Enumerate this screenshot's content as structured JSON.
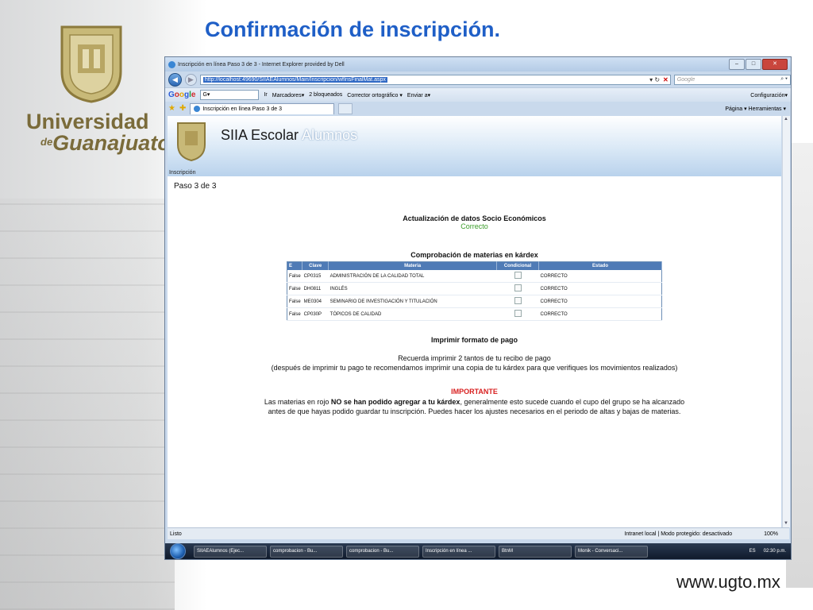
{
  "slide": {
    "title": "Confirmación de inscripción.",
    "university_line1": "Universidad",
    "university_de": "de",
    "university_line2": "Guanajuato",
    "url": "www.ugto.mx"
  },
  "window": {
    "title": "Inscripción en línea Paso 3 de 3 - Internet Explorer provided by Dell",
    "address": "http://localhost:49690/SIIAEAlumnos/Main/Inscripcion/wfInsFinalMat.aspx",
    "search_placeholder": "Google",
    "toolbar": {
      "google_label": "Google",
      "go": "Ir",
      "bookmarks": "Marcadores▾",
      "blocked": "2 bloqueados",
      "spell": "Corrector ortográfico ▾",
      "send": "Enviar a▾",
      "settings": "Configuración▾"
    },
    "tab_label": "Inscripción en línea Paso 3 de 3",
    "command_bar": "Página ▾   Herramientas ▾"
  },
  "page": {
    "app_name": "SIIA Escolar",
    "app_sub": "Alumnos",
    "section_label": "Inscripción",
    "step": "Paso   3 de 3",
    "update_title": "Actualización de datos Socio Económicos",
    "update_status": "Correcto",
    "kardex_title": "Comprobación de materias en kárdex",
    "kardex_headers": [
      "E",
      "Clave",
      "Materia",
      "Condicional",
      "Estado"
    ],
    "kardex_rows": [
      {
        "e": "False",
        "clave": "CP0315",
        "materia": "ADMINISTRACIÓN DE LA CALIDAD TOTAL",
        "estado": "CORRECTO"
      },
      {
        "e": "False",
        "clave": "DH0811",
        "materia": "INGLÉS",
        "estado": "CORRECTO"
      },
      {
        "e": "False",
        "clave": "ME0304",
        "materia": "SEMINARIO DE INVESTIGACIÓN Y TITULACIÓN",
        "estado": "CORRECTO"
      },
      {
        "e": "False",
        "clave": "CP030P",
        "materia": "TÓPICOS DE CALIDAD",
        "estado": "CORRECTO"
      }
    ],
    "print_title": "Imprimir formato de pago",
    "print_line1": "Recuerda imprimir 2 tantos de tu recibo de pago",
    "print_line2": "(después de imprimir tu pago te recomendamos imprimir una copia de tu kárdex para que verifiques los movimientos realizados)",
    "important": "IMPORTANTE",
    "important_pre": "Las materias en rojo ",
    "important_bold": "NO se han podido agregar a tu kárdex",
    "important_post": ", generalmente esto sucede cuando el cupo del grupo se ha alcanzado",
    "important_line2": "antes de que hayas podido guardar tu inscripción. Puedes hacer los ajustes necesarios en el periodo de altas y bajas de materias."
  },
  "statusbar": {
    "left": "Listo",
    "zone": "Intranet local | Modo protegido: desactivado",
    "zoom": "100%"
  },
  "taskbar": {
    "tasks": [
      "SIIAEAlumnos (Ejec...",
      "comprobacion - Bu...",
      "comprobacion - Bu...",
      "Inscripción en línea ...",
      "BtnM",
      "Monik - Conversaci..."
    ],
    "lang": "ES",
    "clock": "02:30 p.m."
  }
}
